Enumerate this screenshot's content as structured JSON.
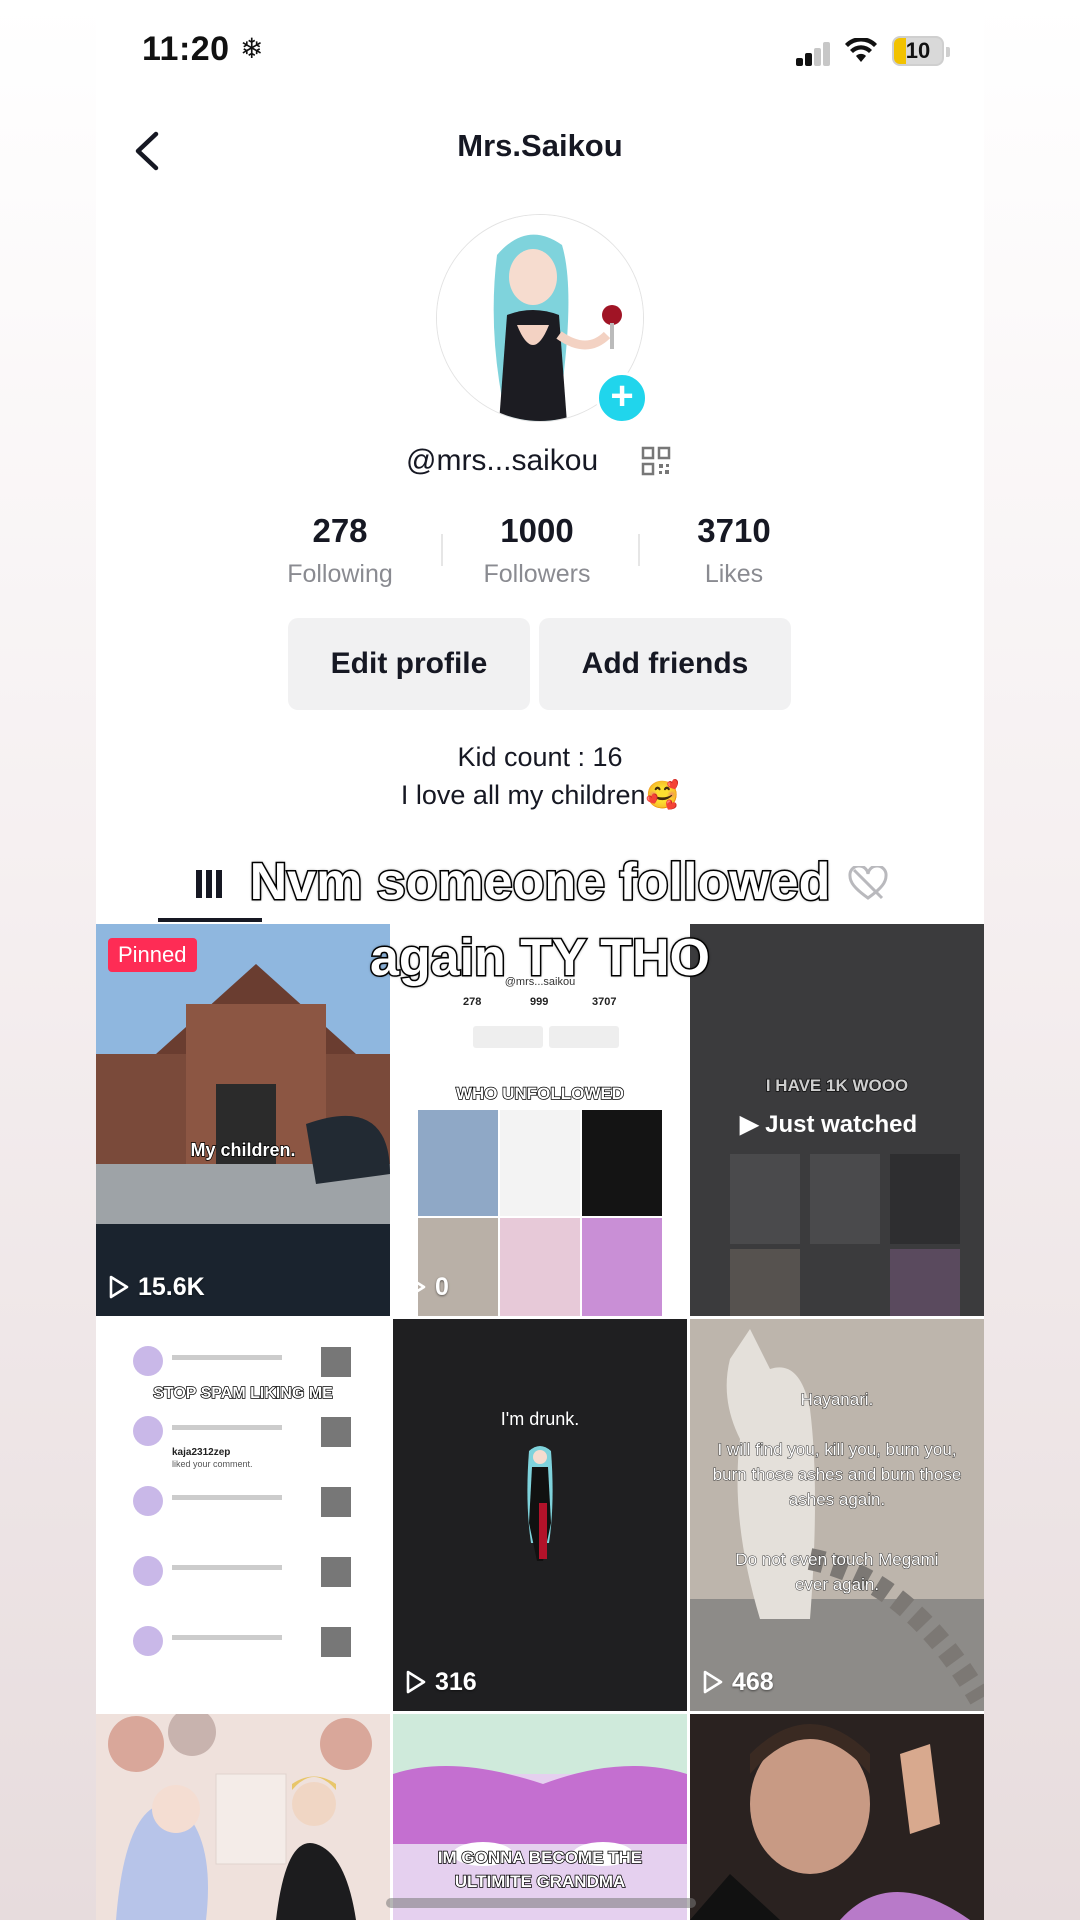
{
  "status_bar": {
    "time": "11:20",
    "battery": "10"
  },
  "header": {
    "title": "Mrs.Saikou"
  },
  "profile": {
    "handle": "@mrs...saikou",
    "stats": [
      {
        "value": "278",
        "label": "Following"
      },
      {
        "value": "1000",
        "label": "Followers"
      },
      {
        "value": "3710",
        "label": "Likes"
      }
    ],
    "buttons": {
      "edit": "Edit profile",
      "add_friends": "Add friends"
    },
    "bio_line1": "Kid count : 16",
    "bio_line2": "I love all my children🥰"
  },
  "overlay": {
    "line1": "Nvm someone followed",
    "line2": "again TY THO"
  },
  "videos": [
    {
      "badge": "Pinned",
      "caption": "My children.",
      "views": "15.6K"
    },
    {
      "caption": "WHO UNFOLLOWED",
      "views": "0",
      "mini_stats": [
        "278",
        "999",
        "3707"
      ],
      "mini_handle": "@mrs...saikou"
    },
    {
      "caption": "I HAVE 1K WOOO",
      "status": "Just watched"
    },
    {
      "caption": "STOP SPAM LIKING ME",
      "commenter": "kaja2312zep",
      "comment_text": "liked your comment."
    },
    {
      "caption": "I'm drunk.",
      "views": "316"
    },
    {
      "caption_title": "Hayanari.",
      "caption_body": "I will find you, kill you, burn you, burn those ashes and burn those ashes again.",
      "caption_end": "Do not even touch Megami ever again.",
      "views": "468"
    },
    {
      "caption": ""
    },
    {
      "caption": "IM GONNA BECOME THE ULTIMITE GRANDMA"
    },
    {
      "caption": ""
    }
  ],
  "colors": {
    "accent": "#fe2c55",
    "follow_plus": "#20d5ec",
    "text": "#161823"
  }
}
